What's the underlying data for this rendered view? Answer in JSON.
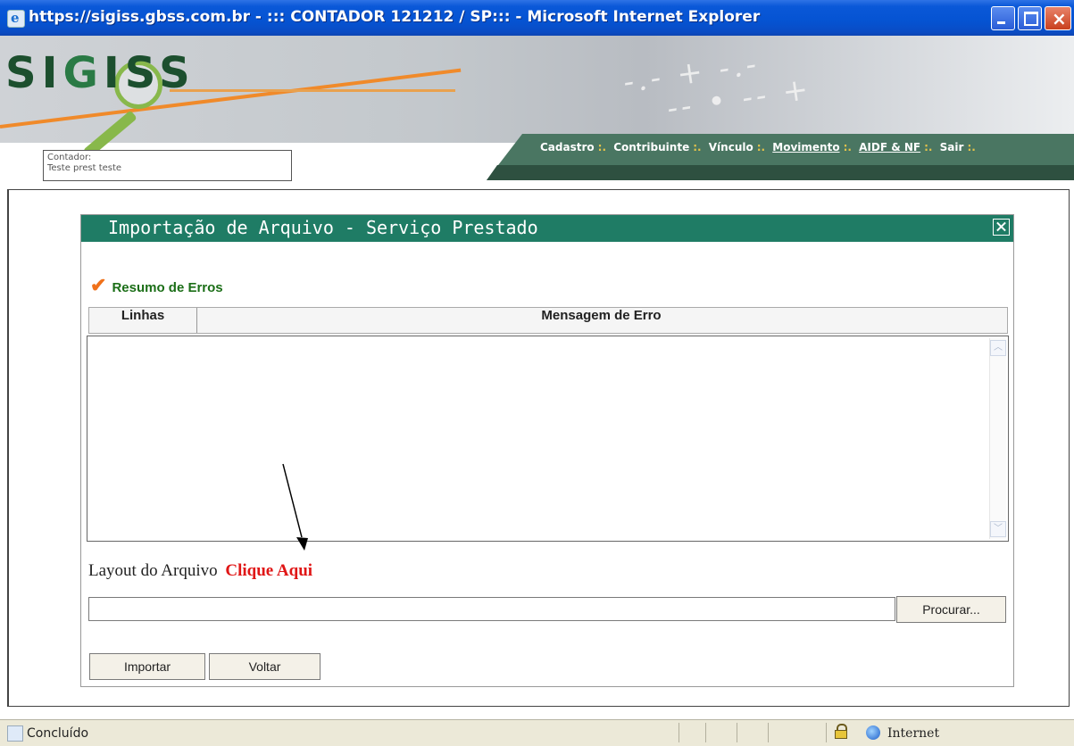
{
  "window": {
    "title": "https://sigiss.gbss.com.br - ::: CONTADOR 121212 / SP::: - Microsoft Internet Explorer",
    "icon": "ie-icon"
  },
  "header": {
    "logo_text": "SIGISS",
    "nav": {
      "items": [
        {
          "label": "Cadastro",
          "underlined": false
        },
        {
          "label": "Contribuinte",
          "underlined": false
        },
        {
          "label": "Vínculo",
          "underlined": false
        },
        {
          "label": "Movimento",
          "underlined": true
        },
        {
          "label": "AIDF & NF",
          "underlined": true
        },
        {
          "label": "Sair",
          "underlined": false
        }
      ],
      "separator": ":."
    },
    "contador": {
      "label": "Contador:",
      "value": "Teste prest teste"
    }
  },
  "dialog": {
    "title": "Importação de Arquivo - Serviço Prestado",
    "section_title": "Resumo de Erros",
    "table": {
      "columns": [
        "Linhas",
        "Mensagem de Erro"
      ],
      "rows": []
    },
    "layout_label": "Layout do Arquivo",
    "layout_link": "Clique Aqui",
    "file_input_value": "",
    "browse_button": "Procurar...",
    "import_button": "Importar",
    "back_button": "Voltar"
  },
  "statusbar": {
    "status_text": "Concluído",
    "zone": "Internet"
  },
  "colors": {
    "dialog_header": "#1f7c65",
    "link_red": "#e01616",
    "section_green": "#1b6e17",
    "check_orange": "#f0711a",
    "nav_band": "#4a7662",
    "titlebar_blue": "#0553d2"
  }
}
